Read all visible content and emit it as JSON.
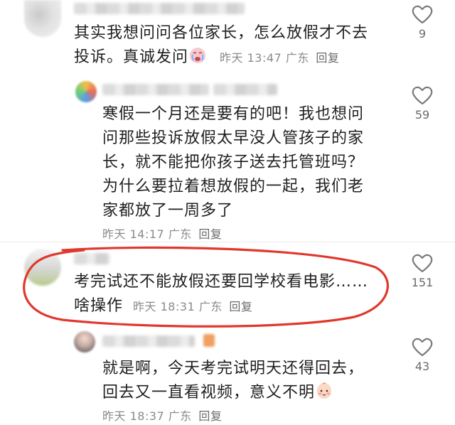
{
  "comments": [
    {
      "text_lines": [
        "其实我想问问各位家长，怎么放假才不去",
        "投诉。真诚发问"
      ],
      "time": "昨天 13:47",
      "location": "广东",
      "reply_label": "回复",
      "likes": "9"
    },
    {
      "text_lines": [
        "寒假一个月还是要有的吧！我也想问",
        "问那些投诉放假太早没人管孩子的家",
        "长，就不能把你孩子送去托管班吗？",
        "为什么要拉着想放假的一起，我们老",
        "家都放了一周多了"
      ],
      "time": "昨天 14:17",
      "location": "广东",
      "reply_label": "回复",
      "likes": "59"
    },
    {
      "text_lines": [
        "考完试还不能放假还要回学校看电影……",
        "啥操作"
      ],
      "time": "昨天 18:31",
      "location": "广东",
      "reply_label": "回复",
      "likes": "151"
    },
    {
      "text_lines": [
        "就是啊，今天考完试明天还得回去，",
        "回去又一直看视频，意义不明"
      ],
      "time": "昨天 18:37",
      "location": "广东",
      "reply_label": "回复",
      "likes": "43"
    }
  ],
  "colors": {
    "annotation_red": "#e0382e",
    "meta_gray": "#8a8a8a",
    "icon_gray": "#7a7a7a"
  },
  "icons": {
    "like": "heart-outline-icon",
    "emoji_crying": "crying-face-emoji-icon",
    "emoji_blush": "blushing-face-emoji-icon"
  }
}
